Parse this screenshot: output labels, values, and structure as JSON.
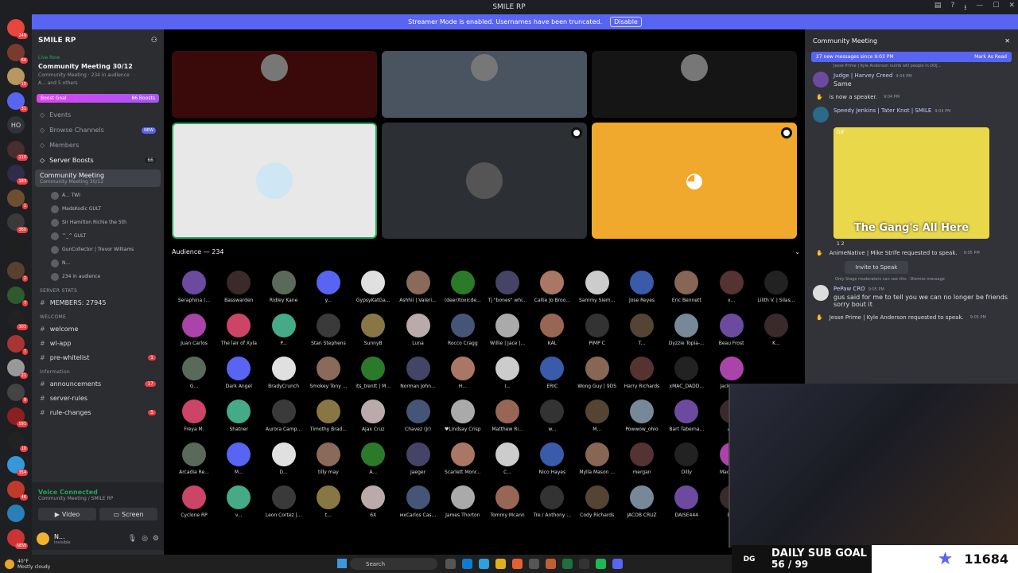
{
  "window": {
    "title": "SMILE RP"
  },
  "banner": {
    "text": "Streamer Mode is enabled. Usernames have been truncated.",
    "button": "Disable"
  },
  "rail": {
    "guilds": [
      {
        "badge": "249",
        "color": "#e8453c"
      },
      {
        "badge": "64",
        "color": "#7a3b2e"
      },
      {
        "badge": "10",
        "color": "#b89860"
      },
      {
        "badge": "31",
        "color": "#5865f2"
      },
      {
        "text": "HO",
        "color": "#313338"
      },
      {
        "badge": "110",
        "color": "#4a2d2d"
      },
      {
        "badge": "183",
        "color": "#2d2d4a"
      },
      {
        "badge": "1",
        "color": "#6b4f2f"
      },
      {
        "badge": "360",
        "color": "#3a3a3a"
      },
      {
        "badge": "",
        "color": "#1f1f1f"
      },
      {
        "badge": "2",
        "color": "#5a4030"
      },
      {
        "badge": "7",
        "color": "#2e5a2e"
      },
      {
        "badge": "301",
        "color": "#222"
      },
      {
        "badge": "7",
        "color": "#aa3333"
      },
      {
        "badge": "21",
        "color": "#999"
      },
      {
        "badge": "9",
        "color": "#444"
      },
      {
        "badge": "591",
        "color": "#8a2020"
      },
      {
        "badge": "10",
        "color": "#222"
      },
      {
        "badge": "354",
        "color": "#3498db"
      },
      {
        "badge": "48",
        "color": "#c0392b"
      },
      {
        "badge": "",
        "color": "#2980b9"
      },
      {
        "badge": "NEW",
        "color": "#cc3333"
      }
    ]
  },
  "sidebar": {
    "server_name": "SMILE RP",
    "live": {
      "tag": "Live Now",
      "title": "Community Meeting 30/12",
      "sub": "Community Meeting · 234 in audience",
      "sub2": "A... and 5 others"
    },
    "boost": {
      "label": "Boost Goal",
      "value": "86 Boosts"
    },
    "nav": [
      {
        "label": "Events",
        "badge": ""
      },
      {
        "label": "Browse Channels",
        "badge": "NEW"
      },
      {
        "label": "Members",
        "badge": ""
      },
      {
        "label": "Server Boosts",
        "badge": "66"
      }
    ],
    "active_channel": {
      "name": "Community Meeting",
      "sub": "Community Meeting 30/12"
    },
    "voice_users": [
      "A... TWI",
      "MadsKodic GULT",
      "Sir Hamilton Richie the 5th",
      "^_^ GULT",
      "GunCollector | Trevor Williams",
      "N...",
      "234 in audience"
    ],
    "categories": [
      {
        "label": "SERVER STATS",
        "channels": [
          {
            "name": "MEMBERS: 27945",
            "badge": ""
          }
        ]
      },
      {
        "label": "WELCOME",
        "channels": [
          {
            "name": "welcome",
            "badge": ""
          },
          {
            "name": "wl-app",
            "badge": ""
          },
          {
            "name": "pre-whitelist",
            "badge": "1"
          }
        ]
      },
      {
        "label": "Information",
        "channels": [
          {
            "name": "announcements",
            "badge": "17"
          },
          {
            "name": "server-rules",
            "badge": ""
          },
          {
            "name": "rule-changes",
            "badge": "5"
          }
        ]
      }
    ],
    "voice": {
      "status": "Voice Connected",
      "sub": "Community Meeting / SMILE RP",
      "video": "Video",
      "screen": "Screen"
    },
    "user": {
      "name": "N...",
      "status": "Invisible"
    }
  },
  "stage": {
    "audience_label": "Audience — 234",
    "tiles_top": [
      {
        "color": "#3a0a0a"
      },
      {
        "color": "#4a5360"
      },
      {
        "color": "#151515"
      }
    ],
    "tiles_mid": [
      {
        "color": "#e8e8e8"
      },
      {
        "color": "#2c2f33"
      },
      {
        "color": "#f0a92c"
      }
    ],
    "members": [
      [
        "Seraphina (...",
        "Basswarden",
        "Ridley Kane",
        "y...",
        "GypsyKatGa...",
        "Ashhii | Valeri...",
        "(deer)toxicde...",
        "Tj \"bones\" whi...",
        "Callie Jo Broo...",
        "Sammy Siem...",
        "Jose Reyes",
        "Eric Bennett",
        "x...",
        "Lilith V. | Silas..."
      ],
      [
        "Juan Carlos",
        "The lair of Xyla",
        "P...",
        "Stan Stephens",
        "SunnyB",
        "Luna",
        "Rocco Cragg",
        "Willie | Jace |...",
        "KAL",
        "PIMP C",
        "T...",
        "Dyzzie Topia-...",
        "Beau Frost",
        "K..."
      ],
      [
        "G...",
        "Dark Angel",
        "BradyCrunch",
        "Smokey Tony ...",
        "its_trentt | M...",
        "Norman John...",
        "H...",
        "I...",
        "ERIC",
        "Wong Guy | 9DS",
        "Harry Richards",
        "xMAC_DADD...",
        "Jackson...",
        ""
      ],
      [
        "Freya M.",
        "Shatner",
        "Aurora Camp...",
        "Timothy Brad...",
        "Ajax Cruz",
        "Chavez (Jr)",
        "♥Lindsay Crisp",
        "Matthew Ri...",
        "w...",
        "M...",
        "Powwow_ohio",
        "Bart Taberna...",
        "A...",
        ""
      ],
      [
        "Arcadia Re...",
        "M...",
        "D...",
        "tilly may",
        "A...",
        "Jaeger",
        "Scarlett Monr...",
        "C...",
        "Nico Hayes",
        "Mylla Mason ...",
        "mergan",
        "Dilly",
        "Maddox...",
        ""
      ],
      [
        "Cyclone RP",
        "v...",
        "Leon Cortez |...",
        "t...",
        "6X",
        "мxCarlos Cas...",
        "James Thorton",
        "Tommy Mcann",
        "Tre / Anthony ...",
        "Cody Richards",
        "JACOB CRUZ",
        "DAISE444",
        "D...",
        ""
      ]
    ],
    "member_colors": [
      "#6b4aa0",
      "#3a2a2a",
      "#5a6a5a",
      "#5865f2",
      "#e0e0e0",
      "#8a6a5a",
      "#2a7a2a",
      "#444466",
      "#aa7766",
      "#cccccc",
      "#3a5aaa",
      "#886655",
      "#553333",
      "#222222",
      "#aa44aa",
      "#cc4466",
      "#44aa88",
      "#3a3a3a",
      "#887744",
      "#bbaaaa",
      "#445577",
      "#aaaaaa",
      "#996655",
      "#333333",
      "#554433",
      "#778899"
    ]
  },
  "chat": {
    "title": "Community Meeting",
    "new_bar": {
      "text": "27 new messages since 9:03 PM",
      "action": "Mark As Read"
    },
    "messages": [
      {
        "reply": "Jesse Prime | Kyle Anderson numb will people in DOJ...",
        "name": "Judge | Harvey Creed",
        "time": "9:04 PM",
        "text": "Same"
      },
      {
        "system": "is now a speaker.",
        "time": "9:04 PM"
      },
      {
        "name": "Speedy Jenkins | Tater Knot | SMILE",
        "time": "9:04 PM",
        "gif_tag": "GIF",
        "gif_caption": "The Gang's All Here",
        "reactions": "1   2"
      },
      {
        "system": "AnimeNative | Mike Strife requested to speak.",
        "time": "9:05 PM",
        "invite": "Invite to Speak",
        "note": "Only Stage moderators can see this · Dismiss message"
      },
      {
        "name": "PePaw CRO",
        "time": "9:05 PM",
        "text": "gus said for me to tell you we can no longer be friends sorry bout it"
      },
      {
        "system": "Jesse Prime | Kyle Anderson requested to speak.",
        "time": "9:05 PM"
      }
    ]
  },
  "overlay": {
    "goal_line1": "DAILY SUB GOAL",
    "goal_line2": "56 / 99",
    "count": "11684",
    "logo": "DG"
  },
  "taskbar": {
    "temp": "40°F",
    "weather": "Mostly cloudy",
    "search": "Search"
  }
}
